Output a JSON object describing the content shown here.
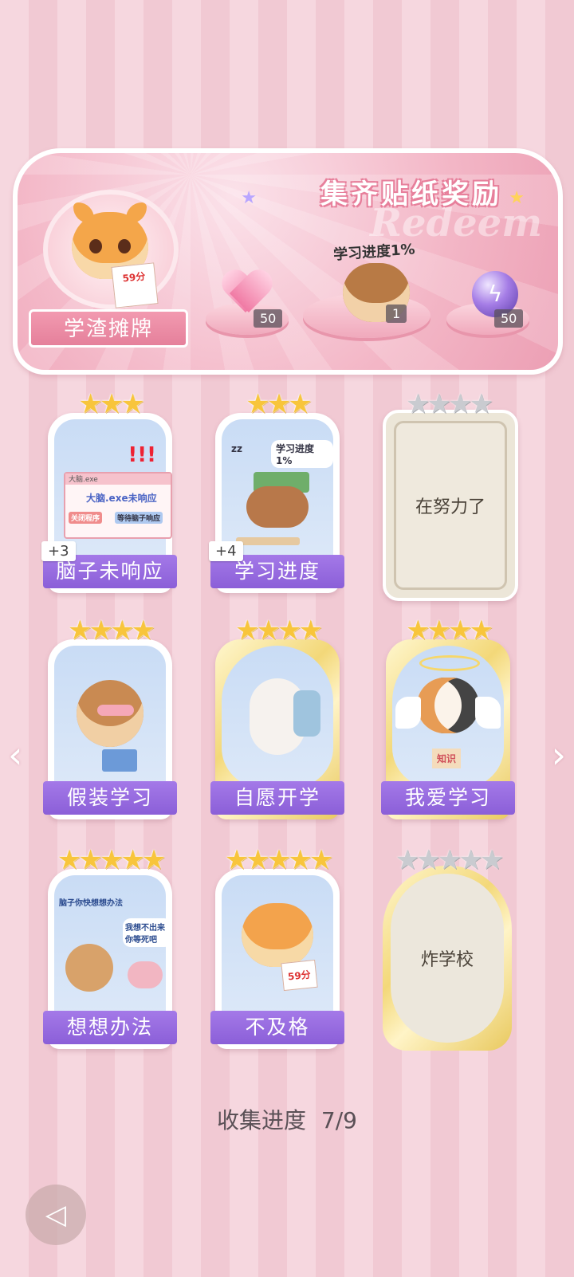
{
  "banner": {
    "title": "集齐贴纸奖励",
    "watermark": "Redeem",
    "player_title": "学渣摊牌",
    "avatar_paper_score": "59分",
    "center_note": "学习进度1%",
    "rewards": [
      {
        "icon": "heart-gem-icon",
        "count": "50"
      },
      {
        "icon": "monkey-sticker-icon",
        "count": "1"
      },
      {
        "icon": "lightning-orb-icon",
        "count": "50"
      }
    ]
  },
  "cards": [
    {
      "label": "脑子未响应",
      "stars": 3,
      "bonus": "+3",
      "art_text_1": "大脑.exe未响应",
      "art_text_2": "关闭程序",
      "art_text_3": "等待脑子响应",
      "window_title": "大脑.exe"
    },
    {
      "label": "学习进度",
      "stars": 3,
      "bonus": "+4",
      "art_text_1": "学习进度1%",
      "art_text_2": "zz"
    },
    {
      "label": "在努力了",
      "stars": 4,
      "locked": true
    },
    {
      "label": "假装学习",
      "stars": 4
    },
    {
      "label": "自愿开学",
      "stars": 4
    },
    {
      "label": "我爱学习",
      "stars": 4,
      "art_text_1": "知识"
    },
    {
      "label": "想想办法",
      "stars": 5,
      "art_text_1": "脑子你快想想办法",
      "art_text_2": "我想不出来你等死吧"
    },
    {
      "label": "不及格",
      "stars": 5,
      "art_text_1": "59分"
    },
    {
      "label": "炸学校",
      "stars": 5,
      "locked": true
    }
  ],
  "progress": {
    "label": "收集进度",
    "value": "7/9"
  },
  "colors": {
    "label_purple": "#9466dd",
    "banner_pink": "#f3b6c6",
    "star_gold": "#f8c53c"
  }
}
